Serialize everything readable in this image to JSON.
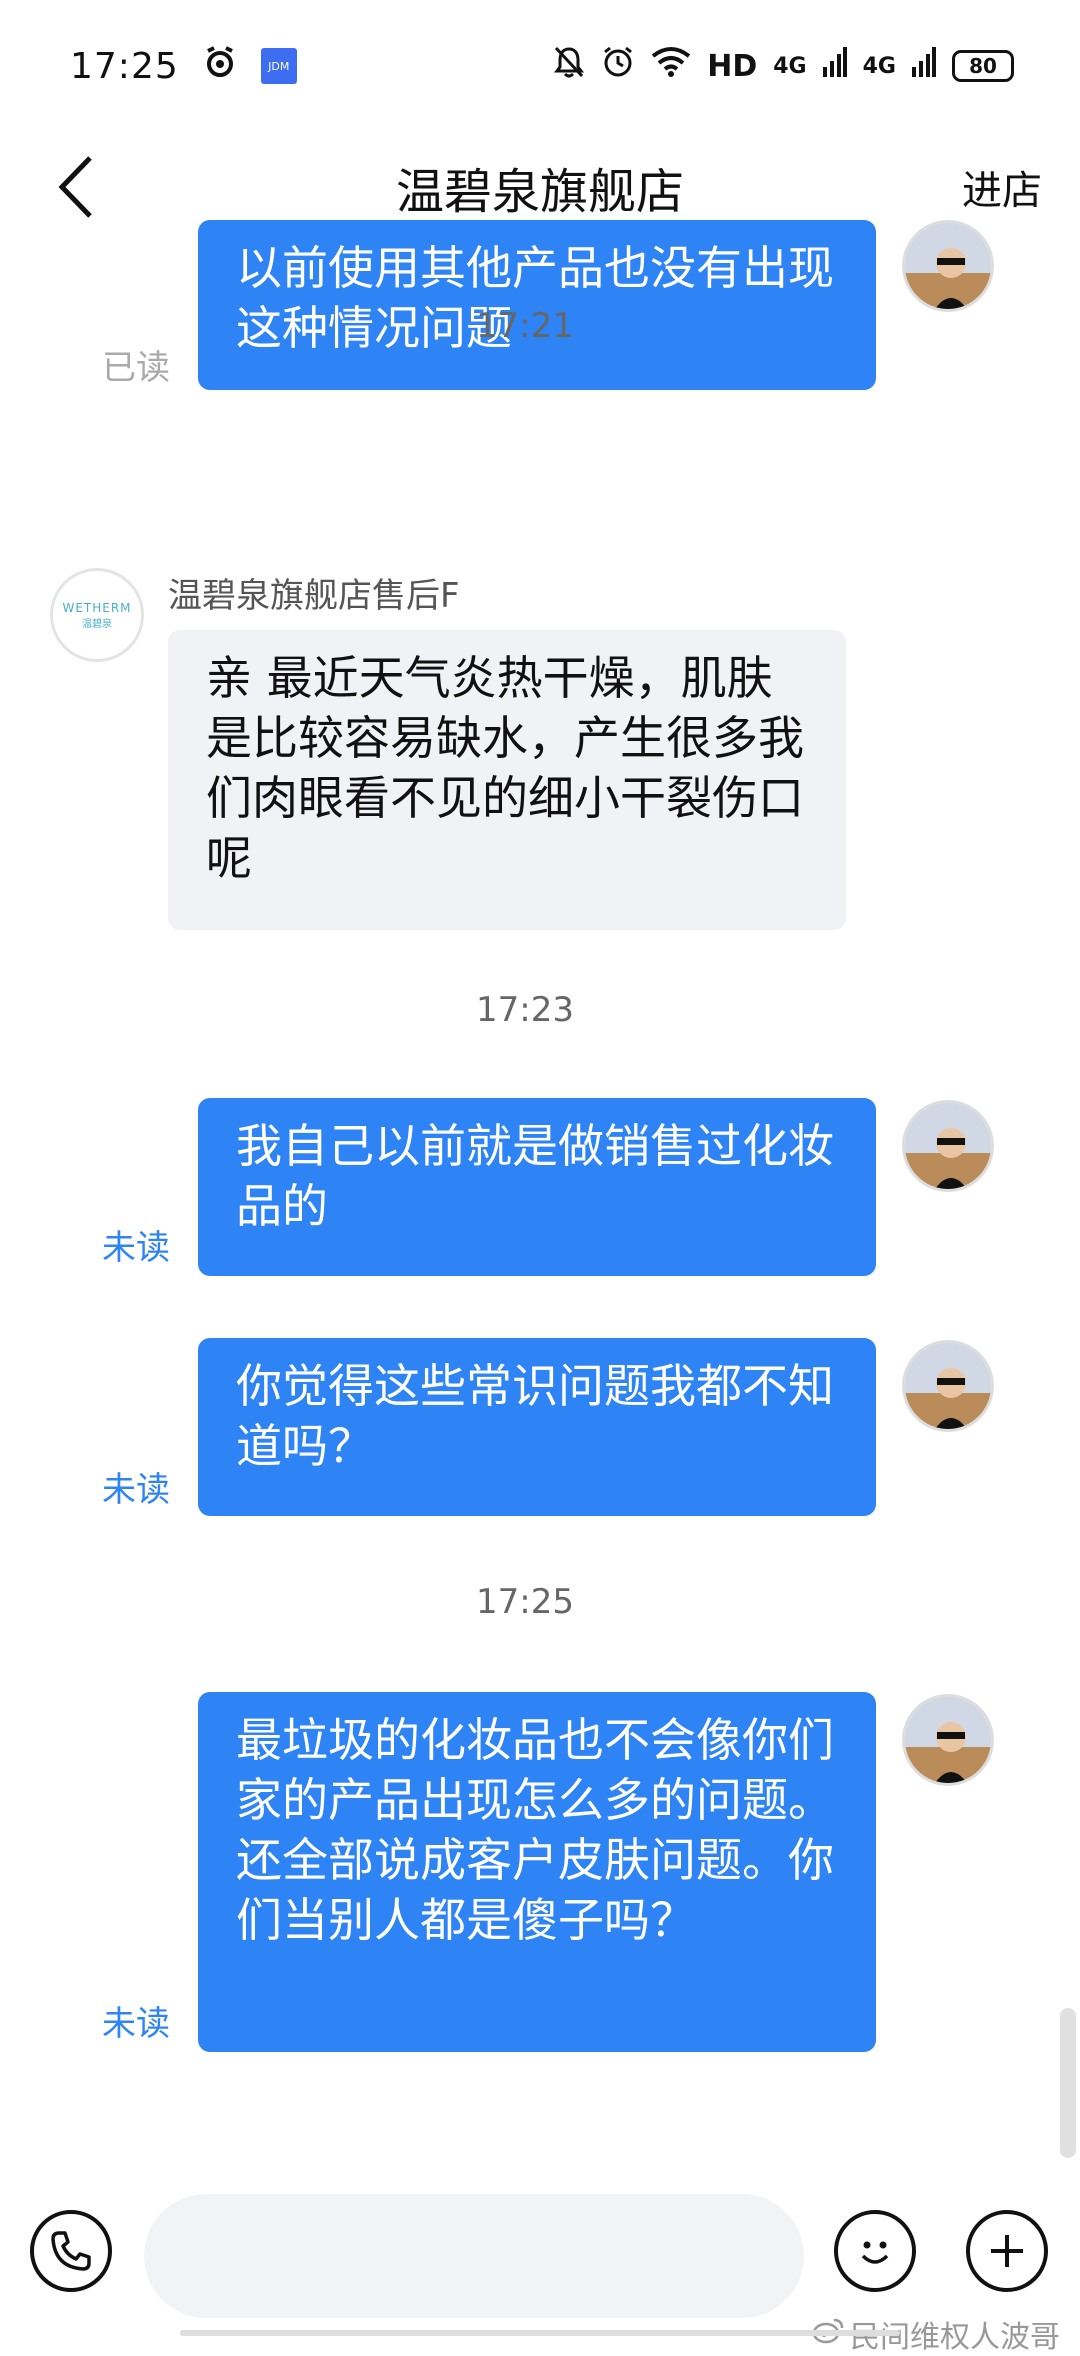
{
  "status_bar": {
    "time": "17:25",
    "app_badge": "JDM",
    "hd_label": "HD",
    "net1": "4G",
    "net2": "4G",
    "battery": "80"
  },
  "header": {
    "title": "温碧泉旗舰店",
    "enter_store": "进店"
  },
  "messages": [
    {
      "type": "out",
      "text": "以前使用其他产品也没有出现这种情况问题",
      "status": "已读"
    },
    {
      "type": "timestamp",
      "text": "17:21"
    },
    {
      "type": "in",
      "sender": "温碧泉旗舰店售后F",
      "avatar_text_1": "WETHERM",
      "avatar_text_2": "温碧泉",
      "text": "亲 最近天气炎热干燥，肌肤是比较容易缺水，产生很多我们肉眼看不见的细小干裂伤口呢"
    },
    {
      "type": "timestamp",
      "text": "17:23"
    },
    {
      "type": "out",
      "text": "我自己以前就是做销售过化妆品的",
      "status": "未读"
    },
    {
      "type": "out",
      "text": "你觉得这些常识问题我都不知道吗？",
      "status": "未读"
    },
    {
      "type": "timestamp",
      "text": "17:25"
    },
    {
      "type": "out",
      "text": "最垃圾的化妆品也不会像你们家的产品出现怎么多的问题。还全部说成客户皮肤问题。你们当别人都是傻子吗？",
      "status": "未读"
    }
  ],
  "input": {
    "placeholder": ""
  },
  "watermark": "民间维权人波哥",
  "colors": {
    "outgoing_bubble": "#2e83f5",
    "incoming_bubble": "#f0f2f6",
    "unread": "#2e83f5",
    "read": "#aaaaaa"
  }
}
